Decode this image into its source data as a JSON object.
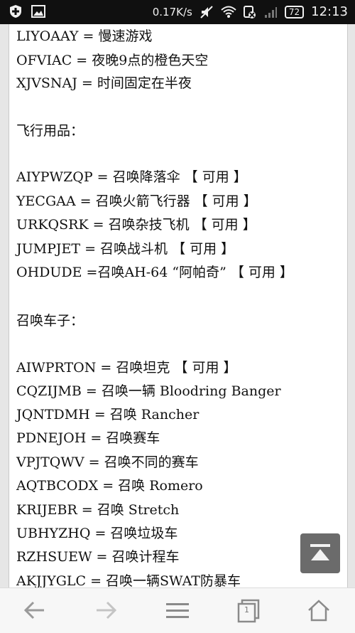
{
  "status_bar": {
    "network_speed": "0.17K/s",
    "battery_level": "72",
    "time": "12:13"
  },
  "content": {
    "lines": [
      "LIYOAAY = 慢速游戏",
      "OFVIAC = 夜晚9点的橙色天空",
      "XJVSNAJ = 时间固定在半夜",
      "飞行用品：",
      "AIYPWZQP = 召唤降落伞 【 可用 】",
      "YECGAA = 召唤火箭飞行器 【 可用 】",
      "URKQSRK = 召唤杂技飞机 【 可用 】",
      "JUMPJET = 召唤战斗机 【 可用 】",
      "OHDUDE =召唤AH-64 “阿帕奇” 【 可用 】",
      "召唤车子：",
      "AIWPRTON = 召唤坦克 【 可用 】",
      "CQZIJMB = 召唤一辆 Bloodring Banger",
      "JQNTDMH = 召唤 Rancher",
      "PDNEJOH = 召唤赛车",
      "VPJTQWV = 召唤不同的赛车",
      "AQTBCODX = 召唤 Romero",
      "KRIJEBR = 召唤 Stretch",
      "UBHYZHQ = 召唤垃圾车",
      "RZHSUEW = 召唤计程车",
      "AKJJYGLC = 召唤一辆SWAT防暴车"
    ]
  },
  "bottom_bar": {
    "tab_count": "1"
  }
}
